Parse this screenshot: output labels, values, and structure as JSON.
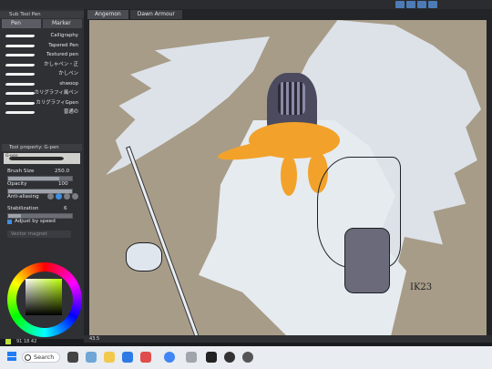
{
  "app": {
    "panel_title": "Sub Tool Pen",
    "tool_tabs": [
      "Pen",
      "Marker"
    ],
    "brushes": [
      "Calligraphy",
      "Tapered Pen",
      "Textured pen",
      "かしゃペン・正",
      "かしペン",
      "shwoop",
      "カリグラフィ風ペン",
      "カリグラフィGpen",
      "普通の"
    ],
    "tool_property_title": "Tool property: G-pen",
    "preview_label": "G-pen",
    "properties": {
      "brush_size_label": "Brush Size",
      "brush_size_value": "250.0",
      "brush_size_fraction": 0.8,
      "opacity_label": "Opacity",
      "opacity_value": "100",
      "opacity_fraction": 1.0,
      "antialiasing_label": "Anti-aliasing",
      "stabilization_label": "Stabilization",
      "stabilization_value": "6",
      "stabilization_fraction": 0.2,
      "adjust_label": "Adjust by speed",
      "vector_label": "Vector magnet"
    },
    "color_readout": "91 18 42",
    "doc_tabs": [
      "Angemon",
      "Dawn Armour"
    ],
    "status_text": "43.5",
    "signature": "IK23"
  },
  "taskbar": {
    "search_label": "Search"
  },
  "colors": {
    "accent": "#3f8fe0",
    "canvas_bg": "#a79c88",
    "selected_color": "#b9e23a"
  }
}
